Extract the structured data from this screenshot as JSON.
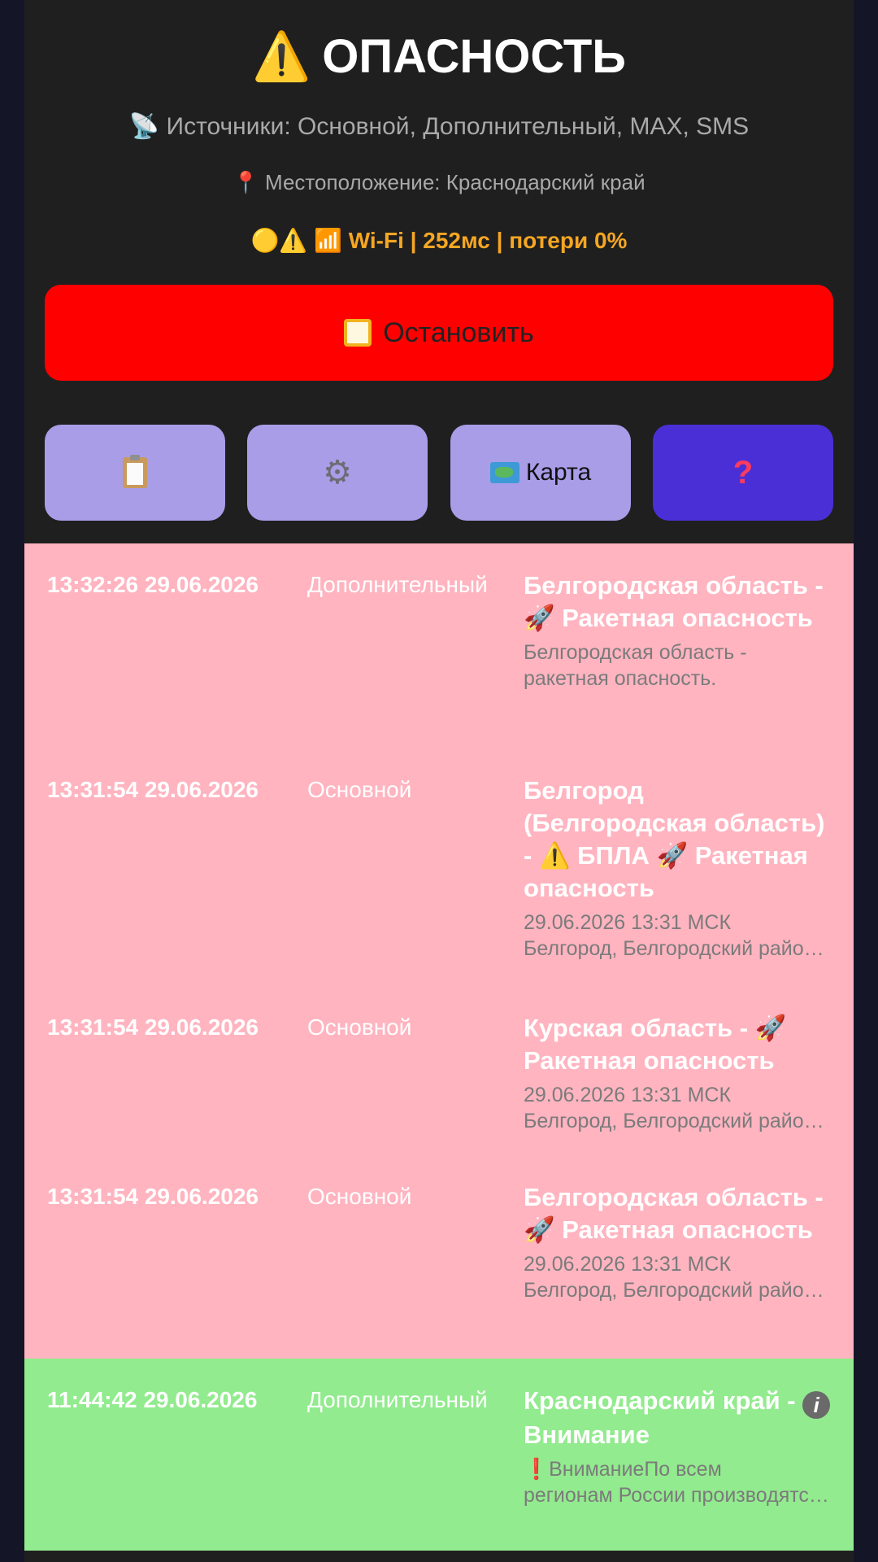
{
  "header": {
    "title_icon": "⚠️",
    "title": "ОПАСНОСТЬ",
    "sources_icon": "📡",
    "sources": "Источники: Основной, Дополнительный, MAX, SMS",
    "location_icon": "📍",
    "location": "Местоположение: Краснодарский край",
    "status_icons": "🟡⚠️ 📶",
    "status": "Wi-Fi | 252мс | потери 0%",
    "status_color": "#f5a623"
  },
  "stop_button": {
    "label": "Остановить",
    "icon": "stop-square-icon",
    "color": "#ff0000"
  },
  "toolbar": {
    "clipboard_icon": "clipboard-icon",
    "settings_icon": "gear-icon",
    "map_icon": "map-icon",
    "map_label": "Карта",
    "help_icon": "question-icon",
    "button_color": "#a99de8",
    "help_color": "#4b2fd6"
  },
  "alerts": [
    {
      "time": "13:32:26 29.06.2026",
      "source": "Дополнительный",
      "title_pre": "Белгородская область - ",
      "title_icon": "🚀",
      "title_post": " Ракетная опасность",
      "sub1": "Белгородская область -",
      "sub2": "ракетная опасность.",
      "kind": "danger"
    },
    {
      "time": "13:31:54 29.06.2026",
      "source": "Основной",
      "title_pre": "Белгород (Белгородская область) - ",
      "title_icon": "⚠️",
      "title_mid": " БПЛА ",
      "title_icon2": "🚀",
      "title_post": " Ракетная опасность",
      "sub1": "29.06.2026 13:31 МСК",
      "sub2": "Белгород, Белгородский район, Белгородская область",
      "kind": "danger"
    },
    {
      "time": "13:31:54 29.06.2026",
      "source": "Основной",
      "title_pre": "Курская область - ",
      "title_icon": "🚀",
      "title_post": " Ракетная опасность",
      "sub1": "29.06.2026 13:31 МСК",
      "sub2": "Белгород, Белгородский район, Курская область",
      "kind": "danger"
    },
    {
      "time": "13:31:54 29.06.2026",
      "source": "Основной",
      "title_pre": "Белгородская область - ",
      "title_icon": "🚀",
      "title_post": " Ракетная опасность",
      "sub1": "29.06.2026 13:31 МСК",
      "sub2": "Белгород, Белгородский район, Белгородская область",
      "kind": "danger"
    },
    {
      "time": "11:44:42 29.06.2026",
      "source": "Дополнительный",
      "title_pre": "Краснодарский край - ",
      "title_icon": "i",
      "title_post": " Внимание",
      "sub1": "❗ВниманиеПо всем",
      "sub2": "регионам России производятся проверки",
      "kind": "info"
    }
  ],
  "colors": {
    "danger_row": "#ffb4c0",
    "info_row": "#92eb8e",
    "panel": "#1f1f1f"
  }
}
